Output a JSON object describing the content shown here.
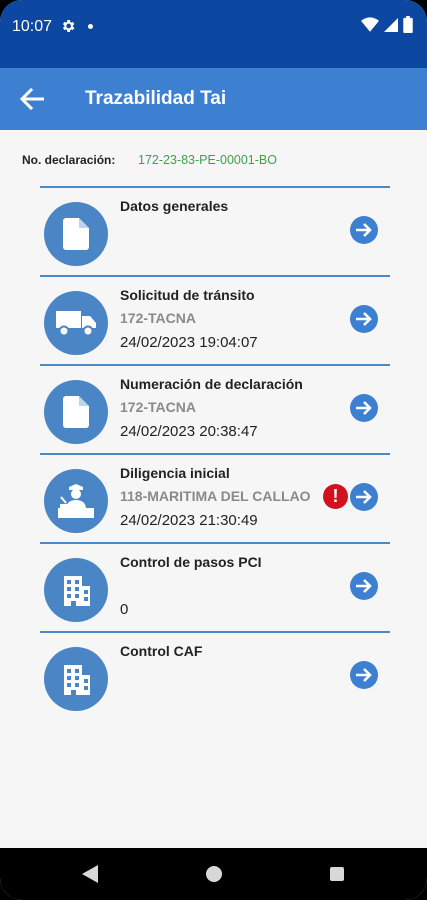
{
  "status_bar": {
    "time": "10:07",
    "icons": [
      "settings-icon",
      "notification-dot",
      "wifi-icon",
      "signal-icon",
      "battery-icon"
    ]
  },
  "app_bar": {
    "title": "Trazabilidad Tai",
    "back_icon": "arrow-left-icon"
  },
  "declaration": {
    "label": "No. declaración:",
    "value": "172-23-83-PE-00001-BO"
  },
  "cards": [
    {
      "title": "Datos generales",
      "subtitle": "",
      "date": "",
      "icon": "document-icon",
      "alert": false
    },
    {
      "title": "Solicitud de tránsito",
      "subtitle": "172-TACNA",
      "date": "24/02/2023 19:04:07",
      "icon": "truck-icon",
      "alert": false
    },
    {
      "title": "Numeración de declaración",
      "subtitle": "172-TACNA",
      "date": "24/02/2023 20:38:47",
      "icon": "document-icon",
      "alert": false
    },
    {
      "title": "Diligencia inicial",
      "subtitle": "118-MARITIMA DEL CALLAO",
      "date": "24/02/2023 21:30:49",
      "icon": "customs-officer-icon",
      "alert": true
    },
    {
      "title": "Control de pasos PCI",
      "subtitle": "",
      "date": "0",
      "icon": "building-icon",
      "alert": false
    },
    {
      "title": "Control CAF",
      "subtitle": "",
      "date": "",
      "icon": "building-icon",
      "alert": false
    }
  ],
  "alert_symbol": "!",
  "colors": {
    "status_bar": "#0c47a1",
    "app_bar": "#3d7fd0",
    "icon_circle": "#4a86c5",
    "declaration_value": "#3aa34a",
    "alert": "#d3101d",
    "subtitle": "#8a8a8a"
  }
}
